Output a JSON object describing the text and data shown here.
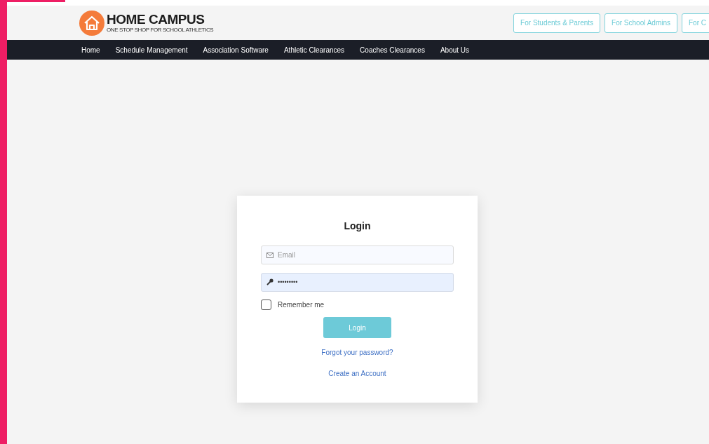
{
  "logo": {
    "title": "HOME CAMPUS",
    "tagline": "ONE STOP SHOP FOR SCHOOL ATHLETICS"
  },
  "header_buttons": [
    "For Students & Parents",
    "For School Admins",
    "For C"
  ],
  "nav": [
    "Home",
    "Schedule Management",
    "Association Software",
    "Athletic Clearances",
    "Coaches Clearances",
    "About Us"
  ],
  "login": {
    "title": "Login",
    "email": {
      "placeholder": "Email"
    },
    "password": {
      "value": "•••••••••"
    },
    "remember": {
      "label": "Remember me",
      "checked": false
    },
    "button": "Login",
    "links": [
      "Forgot your password?",
      "Create an Account"
    ]
  }
}
